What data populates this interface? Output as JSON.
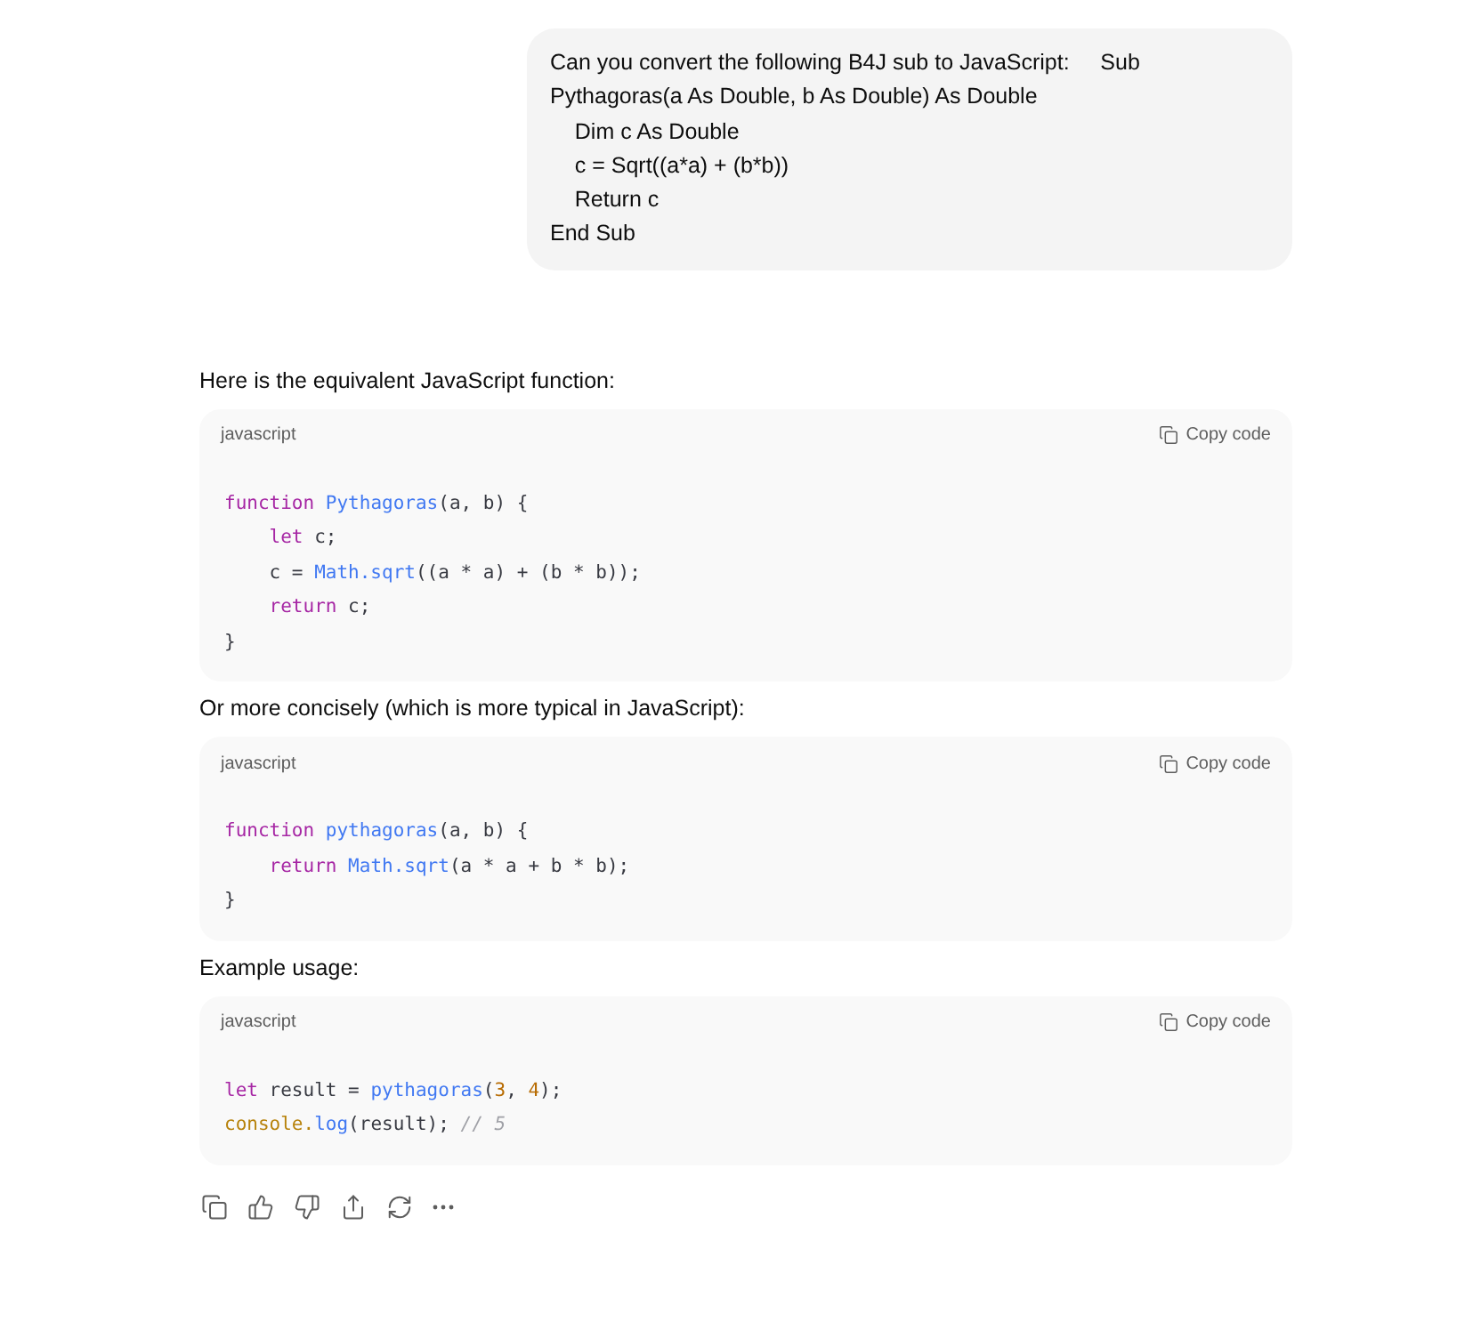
{
  "user_message": {
    "lines": [
      "Can you convert the following B4J sub to JavaScript:     Sub",
      "Pythagoras(a As Double, b As Double) As Double",
      "    Dim c As Double",
      "    c = Sqrt((a*a) + (b*b))",
      "    Return c",
      "End Sub"
    ]
  },
  "response": [
    {
      "kind": "text",
      "text": "Here is the equivalent JavaScript function:"
    },
    {
      "kind": "code",
      "language": "javascript",
      "copy_label": "Copy code",
      "lines": [
        [
          {
            "kind": "keyword",
            "text": "function "
          },
          {
            "kind": "function",
            "text": "Pythagoras"
          },
          {
            "kind": "plain",
            "text": "(a, b) {"
          }
        ],
        [
          {
            "kind": "keyword",
            "text": "    let"
          },
          {
            "kind": "plain",
            "text": " c;"
          }
        ],
        [
          {
            "kind": "plain",
            "text": "    c = "
          },
          {
            "kind": "function",
            "text": "Math.sqrt"
          },
          {
            "kind": "plain",
            "text": "((a * a) + (b * b));"
          }
        ],
        [
          {
            "kind": "keyword",
            "text": "    return"
          },
          {
            "kind": "plain",
            "text": " c;"
          }
        ],
        [
          {
            "kind": "plain",
            "text": "}"
          }
        ]
      ]
    },
    {
      "kind": "text",
      "text": "Or more concisely (which is more typical in JavaScript):"
    },
    {
      "kind": "code",
      "language": "javascript",
      "copy_label": "Copy code",
      "lines": [
        [
          {
            "kind": "keyword",
            "text": "function "
          },
          {
            "kind": "function",
            "text": "pythagoras"
          },
          {
            "kind": "plain",
            "text": "(a, b) {"
          }
        ],
        [
          {
            "kind": "keyword",
            "text": "    return "
          },
          {
            "kind": "function",
            "text": "Math.sqrt"
          },
          {
            "kind": "plain",
            "text": "(a * a + b * b);"
          }
        ],
        [
          {
            "kind": "plain",
            "text": "}"
          }
        ]
      ]
    },
    {
      "kind": "text",
      "text": "Example usage:"
    },
    {
      "kind": "code",
      "language": "javascript",
      "copy_label": "Copy code",
      "lines": [
        [
          {
            "kind": "keyword",
            "text": "let"
          },
          {
            "kind": "plain",
            "text": " result = "
          },
          {
            "kind": "function",
            "text": "pythagoras"
          },
          {
            "kind": "plain",
            "text": "("
          },
          {
            "kind": "number",
            "text": "3"
          },
          {
            "kind": "plain",
            "text": ", "
          },
          {
            "kind": "number",
            "text": "4"
          },
          {
            "kind": "plain",
            "text": ");"
          }
        ],
        [
          {
            "kind": "builtin",
            "text": "console."
          },
          {
            "kind": "function",
            "text": "log"
          },
          {
            "kind": "plain",
            "text": "(result); "
          },
          {
            "kind": "comment",
            "text": "// 5"
          }
        ]
      ]
    }
  ],
  "actions": [
    {
      "kind": "copy"
    },
    {
      "kind": "thumbs_up"
    },
    {
      "kind": "thumbs_down"
    },
    {
      "kind": "share"
    },
    {
      "kind": "regenerate"
    },
    {
      "kind": "more"
    }
  ]
}
